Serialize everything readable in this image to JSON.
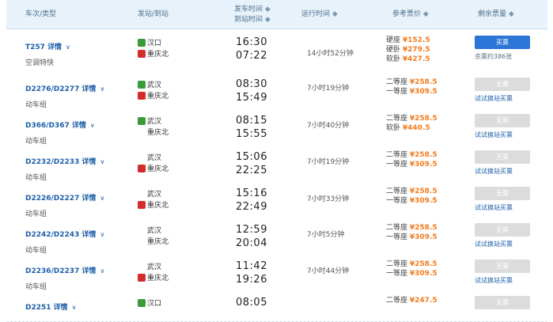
{
  "header": {
    "train_label": "车次/类型",
    "station_label": "发站/到站",
    "depart_label": "发车时间",
    "arrive_label": "到站时间",
    "duration_label": "运行时间",
    "price_label": "参考票价",
    "tickets_label": "剩余票量",
    "sort_icon": "sort-arrow"
  },
  "rows": [
    {
      "code": "T257",
      "detail": "详情",
      "type": "空调特快",
      "from": "汉口",
      "from_badge": "start",
      "to": "重庆北",
      "to_badge": "end",
      "depart": "16:30",
      "arrive": "07:22",
      "duration": "14小时52分钟",
      "prices": [
        {
          "seat": "硬座",
          "price": "¥152.5"
        },
        {
          "seat": "硬卧",
          "price": "¥279.5"
        },
        {
          "seat": "软卧",
          "price": "¥427.5"
        }
      ],
      "button": "买票",
      "button_state": "on",
      "note": "余票约386张"
    },
    {
      "code": "D2276/D2277",
      "detail": "详情",
      "type": "动车组",
      "from": "武汉",
      "from_badge": "start",
      "to": "重庆北",
      "to_badge": "end",
      "depart": "08:30",
      "arrive": "15:49",
      "duration": "7小时19分钟",
      "prices": [
        {
          "seat": "二等座",
          "price": "¥258.5"
        },
        {
          "seat": "一等座",
          "price": "¥309.5"
        }
      ],
      "button": "无票",
      "button_state": "off",
      "note": "试试换站买票"
    },
    {
      "code": "D366/D367",
      "detail": "详情",
      "type": "动车组",
      "from": "武汉",
      "from_badge": "start",
      "to": "重庆北",
      "to_badge": "none",
      "depart": "08:15",
      "arrive": "15:55",
      "duration": "7小时40分钟",
      "prices": [
        {
          "seat": "二等座",
          "price": "¥258.5"
        },
        {
          "seat": "软卧",
          "price": "¥440.5"
        }
      ],
      "button": "无票",
      "button_state": "off",
      "note": "试试换站买票"
    },
    {
      "code": "D2232/D2233",
      "detail": "详情",
      "type": "动车组",
      "from": "武汉",
      "from_badge": "none",
      "to": "重庆北",
      "to_badge": "end",
      "depart": "15:06",
      "arrive": "22:25",
      "duration": "7小时19分钟",
      "prices": [
        {
          "seat": "二等座",
          "price": "¥258.5"
        },
        {
          "seat": "一等座",
          "price": "¥309.5"
        }
      ],
      "button": "无票",
      "button_state": "off",
      "note": "试试换站买票"
    },
    {
      "code": "D2226/D2227",
      "detail": "详情",
      "type": "动车组",
      "from": "武汉",
      "from_badge": "none",
      "to": "重庆北",
      "to_badge": "end",
      "depart": "15:16",
      "arrive": "22:49",
      "duration": "7小时33分钟",
      "prices": [
        {
          "seat": "二等座",
          "price": "¥258.5"
        },
        {
          "seat": "一等座",
          "price": "¥309.5"
        }
      ],
      "button": "无票",
      "button_state": "off",
      "note": "试试换站买票"
    },
    {
      "code": "D2242/D2243",
      "detail": "详情",
      "type": "动车组",
      "from": "武汉",
      "from_badge": "none",
      "to": "重庆北",
      "to_badge": "none",
      "depart": "12:59",
      "arrive": "20:04",
      "duration": "7小时5分钟",
      "prices": [
        {
          "seat": "二等座",
          "price": "¥258.5"
        },
        {
          "seat": "一等座",
          "price": "¥309.5"
        }
      ],
      "button": "无票",
      "button_state": "off",
      "note": "试试换站买票"
    },
    {
      "code": "D2236/D2237",
      "detail": "详情",
      "type": "动车组",
      "from": "武汉",
      "from_badge": "none",
      "to": "重庆北",
      "to_badge": "end",
      "depart": "11:42",
      "arrive": "19:26",
      "duration": "7小时44分钟",
      "prices": [
        {
          "seat": "二等座",
          "price": "¥258.5"
        },
        {
          "seat": "一等座",
          "price": "¥309.5"
        }
      ],
      "button": "无票",
      "button_state": "off",
      "note": "试试换站买票"
    },
    {
      "code": "D2251",
      "detail": "详情",
      "type": "",
      "from": "汉口",
      "from_badge": "start",
      "to": "",
      "to_badge": "none",
      "depart": "08:05",
      "arrive": "",
      "duration": "",
      "prices": [
        {
          "seat": "二等座",
          "price": "¥247.5"
        }
      ],
      "button": "无票",
      "button_state": "off",
      "note": ""
    }
  ]
}
